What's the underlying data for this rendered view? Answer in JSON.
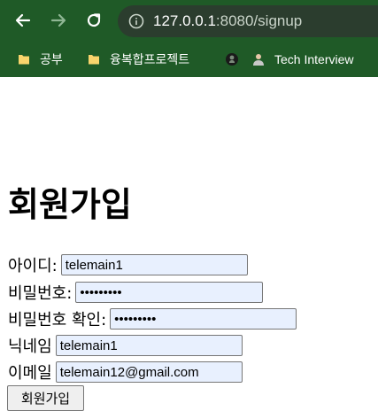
{
  "browser": {
    "url_host": "127.0.0.1",
    "url_rest": ":8080/signup",
    "bookmarks": [
      "공부",
      "융복합프로젝트",
      "Tech Interview"
    ]
  },
  "page": {
    "title": "회원가입",
    "fields": [
      {
        "label": "아이디:",
        "value": "telemain1",
        "type": "text"
      },
      {
        "label": "비밀번호:",
        "value": "•••••••••",
        "type": "password"
      },
      {
        "label": "비밀번호 확인:",
        "value": "•••••••••",
        "type": "password"
      },
      {
        "label": "닉네임",
        "value": "telemain1",
        "type": "text"
      },
      {
        "label": "이메일",
        "value": "telemain12@gmail.com",
        "type": "text"
      }
    ],
    "submit_label": "회원가입"
  },
  "colors": {
    "chrome_bg": "#1f5a27",
    "input_autofill_bg": "#e8f0fe"
  }
}
